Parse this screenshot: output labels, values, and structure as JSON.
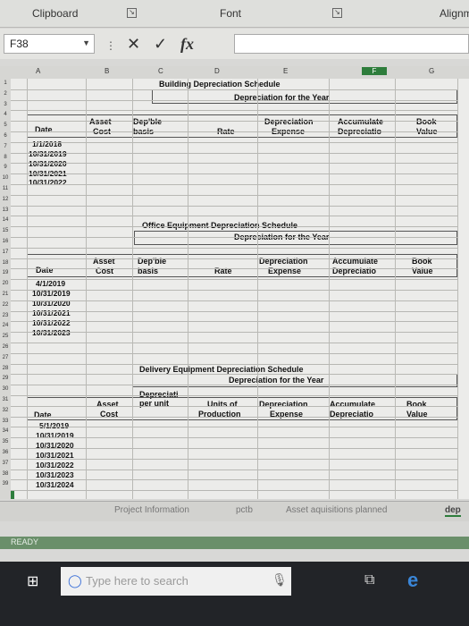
{
  "ribbon": {
    "clipboard": "Clipboard",
    "font": "Font",
    "alignment": "Alignm"
  },
  "formula_bar": {
    "name_box": "F38",
    "cancel": "✕",
    "enter": "✓",
    "fx": "fx"
  },
  "columns": [
    "A",
    "B",
    "C",
    "D",
    "E",
    "F",
    "G"
  ],
  "rows": [
    "1",
    "2",
    "3",
    "4",
    "5",
    "6",
    "7",
    "8",
    "9",
    "10",
    "11",
    "12",
    "13",
    "14",
    "15",
    "16",
    "17",
    "18",
    "19",
    "20",
    "21",
    "22",
    "23",
    "24",
    "25",
    "26",
    "27",
    "28",
    "29",
    "30",
    "31",
    "32",
    "33",
    "34",
    "35",
    "36",
    "37",
    "38",
    "39"
  ],
  "building": {
    "title": "Building Depreciation Schedule",
    "subtitle": "Depreciation for the Year",
    "headers": {
      "date": "Date",
      "asset1": "Asset",
      "asset2": "Cost",
      "dep1": "Dep'ble",
      "dep2": "basis",
      "rate": "Rate",
      "depr1": "Depreciation",
      "depr2": "Expense",
      "acc1": "Accumulate",
      "acc2": "Depreciatio",
      "book1": "Book",
      "book2": "Value"
    },
    "dates": [
      "1/1/2018",
      "10/31/2019",
      "10/31/2020",
      "10/31/2021",
      "10/31/2022"
    ]
  },
  "office": {
    "title": "Office Equipment Depreciation Schedule",
    "subtitle": "Depreciation for the Year",
    "headers": {
      "date": "Date",
      "asset1": "Asset",
      "asset2": "Cost",
      "dep1": "Dep'ble",
      "dep2": "basis",
      "rate": "Rate",
      "depr1": "Depreciation",
      "depr2": "Expense",
      "acc1": "Accumulate",
      "acc2": "Depreciatio",
      "book1": "Book",
      "book2": "Value"
    },
    "dates": [
      "4/1/2019",
      "10/31/2019",
      "10/31/2020",
      "10/31/2021",
      "10/31/2022",
      "10/31/2023"
    ]
  },
  "delivery": {
    "title": "Delivery Equipment Depreciation Schedule",
    "subtitle": "Depreciation for the Year",
    "headers": {
      "date": "Date",
      "asset1": "Asset",
      "asset2": "Cost",
      "dep1": "Depreciati",
      "dep2": "per unit",
      "units1": "Units of",
      "units2": "Production",
      "depr1": "Depreciation",
      "depr2": "Expense",
      "acc1": "Accumulate",
      "acc2": "Depreciatio",
      "book1": "Book",
      "book2": "Value"
    },
    "dates": [
      "5/1/2019",
      "10/31/2019",
      "10/31/2020",
      "10/31/2021",
      "10/31/2022",
      "10/31/2023",
      "10/31/2024"
    ]
  },
  "tabs": [
    "Project Information",
    "pctb",
    "Asset aquisitions planned",
    "dep"
  ],
  "status": "READY",
  "taskbar": {
    "search_placeholder": "Type here to search"
  },
  "colors": {
    "selection": "#2e7d3c",
    "status_bar": "#6a8f6a",
    "taskbar": "#222428"
  }
}
